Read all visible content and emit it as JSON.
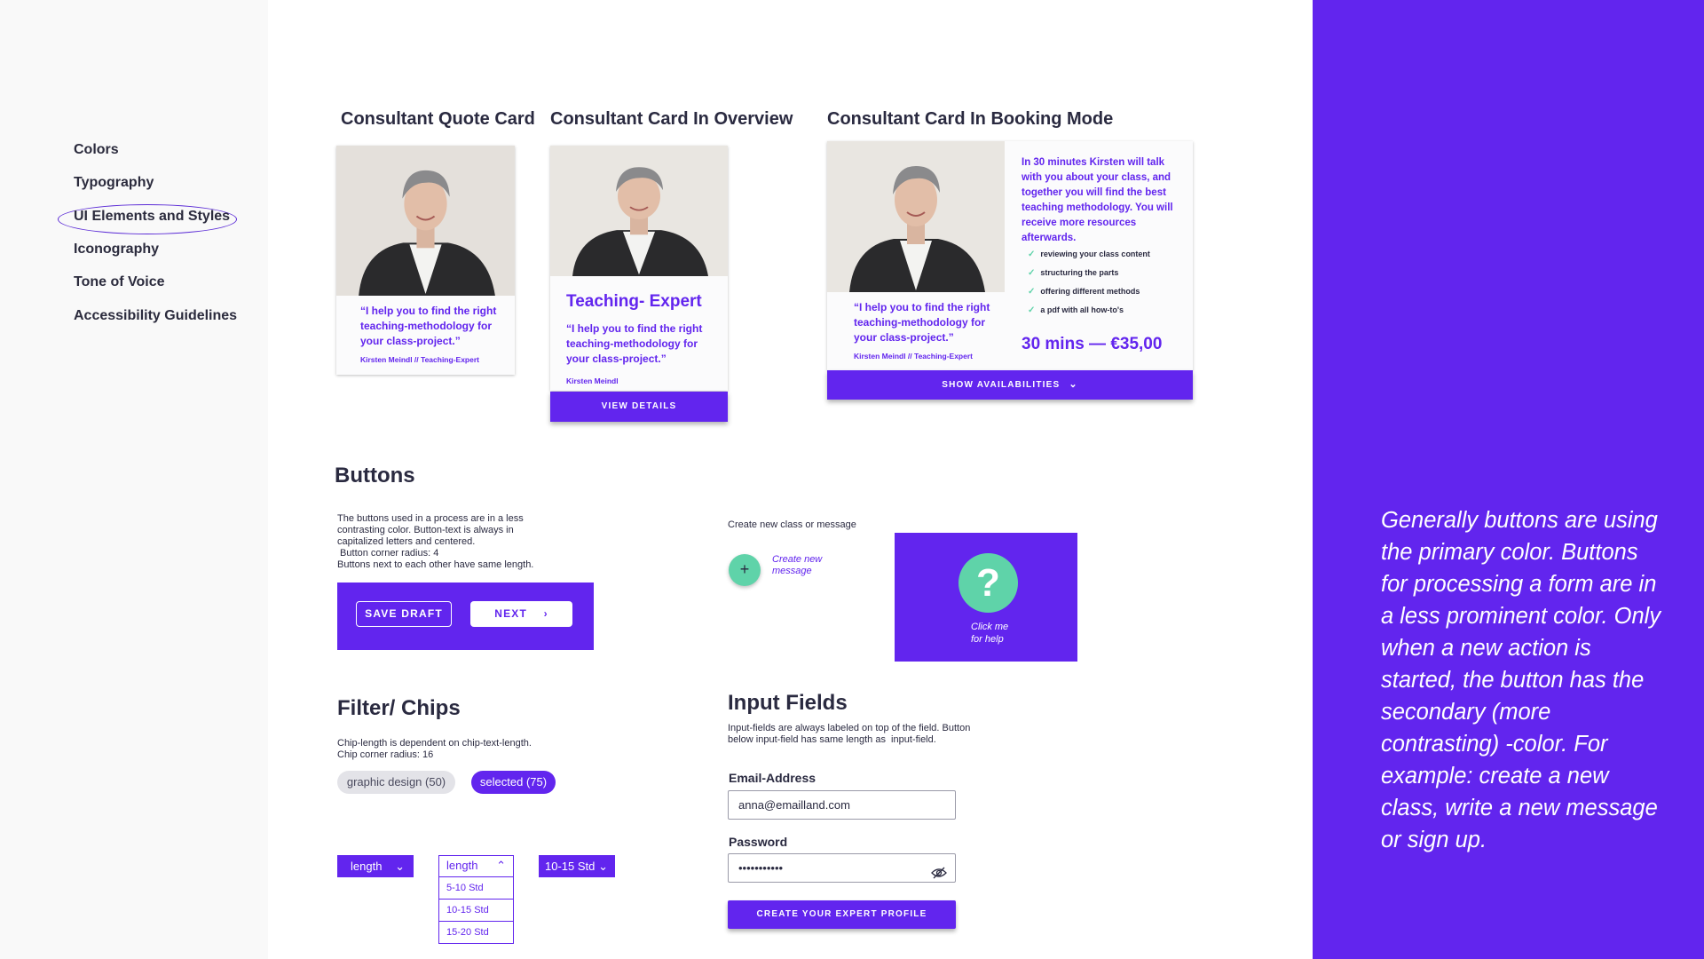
{
  "sidebar": {
    "items": [
      {
        "label": "Colors"
      },
      {
        "label": "Typography"
      },
      {
        "label": "UI Elements and Styles"
      },
      {
        "label": "Iconography"
      },
      {
        "label": "Tone of Voice"
      },
      {
        "label": "Accessibility Guidelines"
      }
    ],
    "active_index": 2
  },
  "cards": {
    "quote_card": {
      "title": "Consultant Quote Card",
      "quote": "“I help you to find the right teaching-methodology for your class-project.”",
      "author": "Kirsten Meindl // Teaching-Expert"
    },
    "overview_card": {
      "title": "Consultant Card In Overview",
      "role": "Teaching- Expert",
      "quote": "“I help you to find the right teaching-methodology for your class-project.”",
      "author": "Kirsten Meindl",
      "button": "VIEW DETAILS"
    },
    "booking_card": {
      "title": "Consultant Card In Booking Mode",
      "quote": "“I help you to find the right teaching-methodology for your class-project.”",
      "author": "Kirsten Meindl // Teaching-Expert",
      "description": "In 30 minutes Kirsten will talk with you about your class, and together you will find the best teaching methodology. You will receive more resources afterwards.",
      "checklist": [
        "reviewing your class content",
        "structuring the parts",
        "offering different methods",
        "a pdf with all how-to's"
      ],
      "price": "30 mins — €35,00",
      "button": "SHOW AVAILABILITIES"
    }
  },
  "buttons": {
    "title": "Buttons",
    "description": [
      "The buttons used in a process are in a less",
      "contrasting color. Button-text is always in",
      "capitalized letters and centered.",
      " Button corner radius: 4",
      "Buttons next to each other have same length."
    ],
    "save_draft": "SAVE DRAFT",
    "next": "NEXT",
    "create_caption": "Create new class or message",
    "create_fab_label": [
      "Create new",
      "message"
    ],
    "help_label": [
      "Click me",
      "for help"
    ]
  },
  "chips": {
    "title": "Filter/ Chips",
    "description": [
      "Chip-length is dependent on chip-text-length.",
      "Chip corner radius: 16"
    ],
    "chip_default": "graphic design (50)",
    "chip_selected": "selected (75)",
    "dropdown_closed": "length",
    "dropdown_open": "length",
    "dropdown_options": [
      "5-10 Std",
      "10-15 Std",
      "15-20 Std"
    ],
    "dropdown_selected": "10-15 Std"
  },
  "inputs": {
    "title": "Input Fields",
    "description": [
      "Input-fields are always labeled on top of the field. Button",
      "below input-field has same length as  input-field."
    ],
    "email_label": "Email-Address",
    "email_value": "anna@emailland.com",
    "password_label": "Password",
    "password_value": "•••••••••••",
    "submit": "CREATE YOUR EXPERT PROFILE"
  },
  "side_note": "Generally buttons are using the primary color. Buttons for processing a form are in a less prominent color. Only when a new action is started, the button has the secondary (more contrasting) -color. For example: create a new class, write a new message or sign up.",
  "colors": {
    "primary": "#6225ee",
    "secondary": "#5fd3a9",
    "text": "#2a2a40",
    "sidebar_bg": "#f9f9f9"
  }
}
